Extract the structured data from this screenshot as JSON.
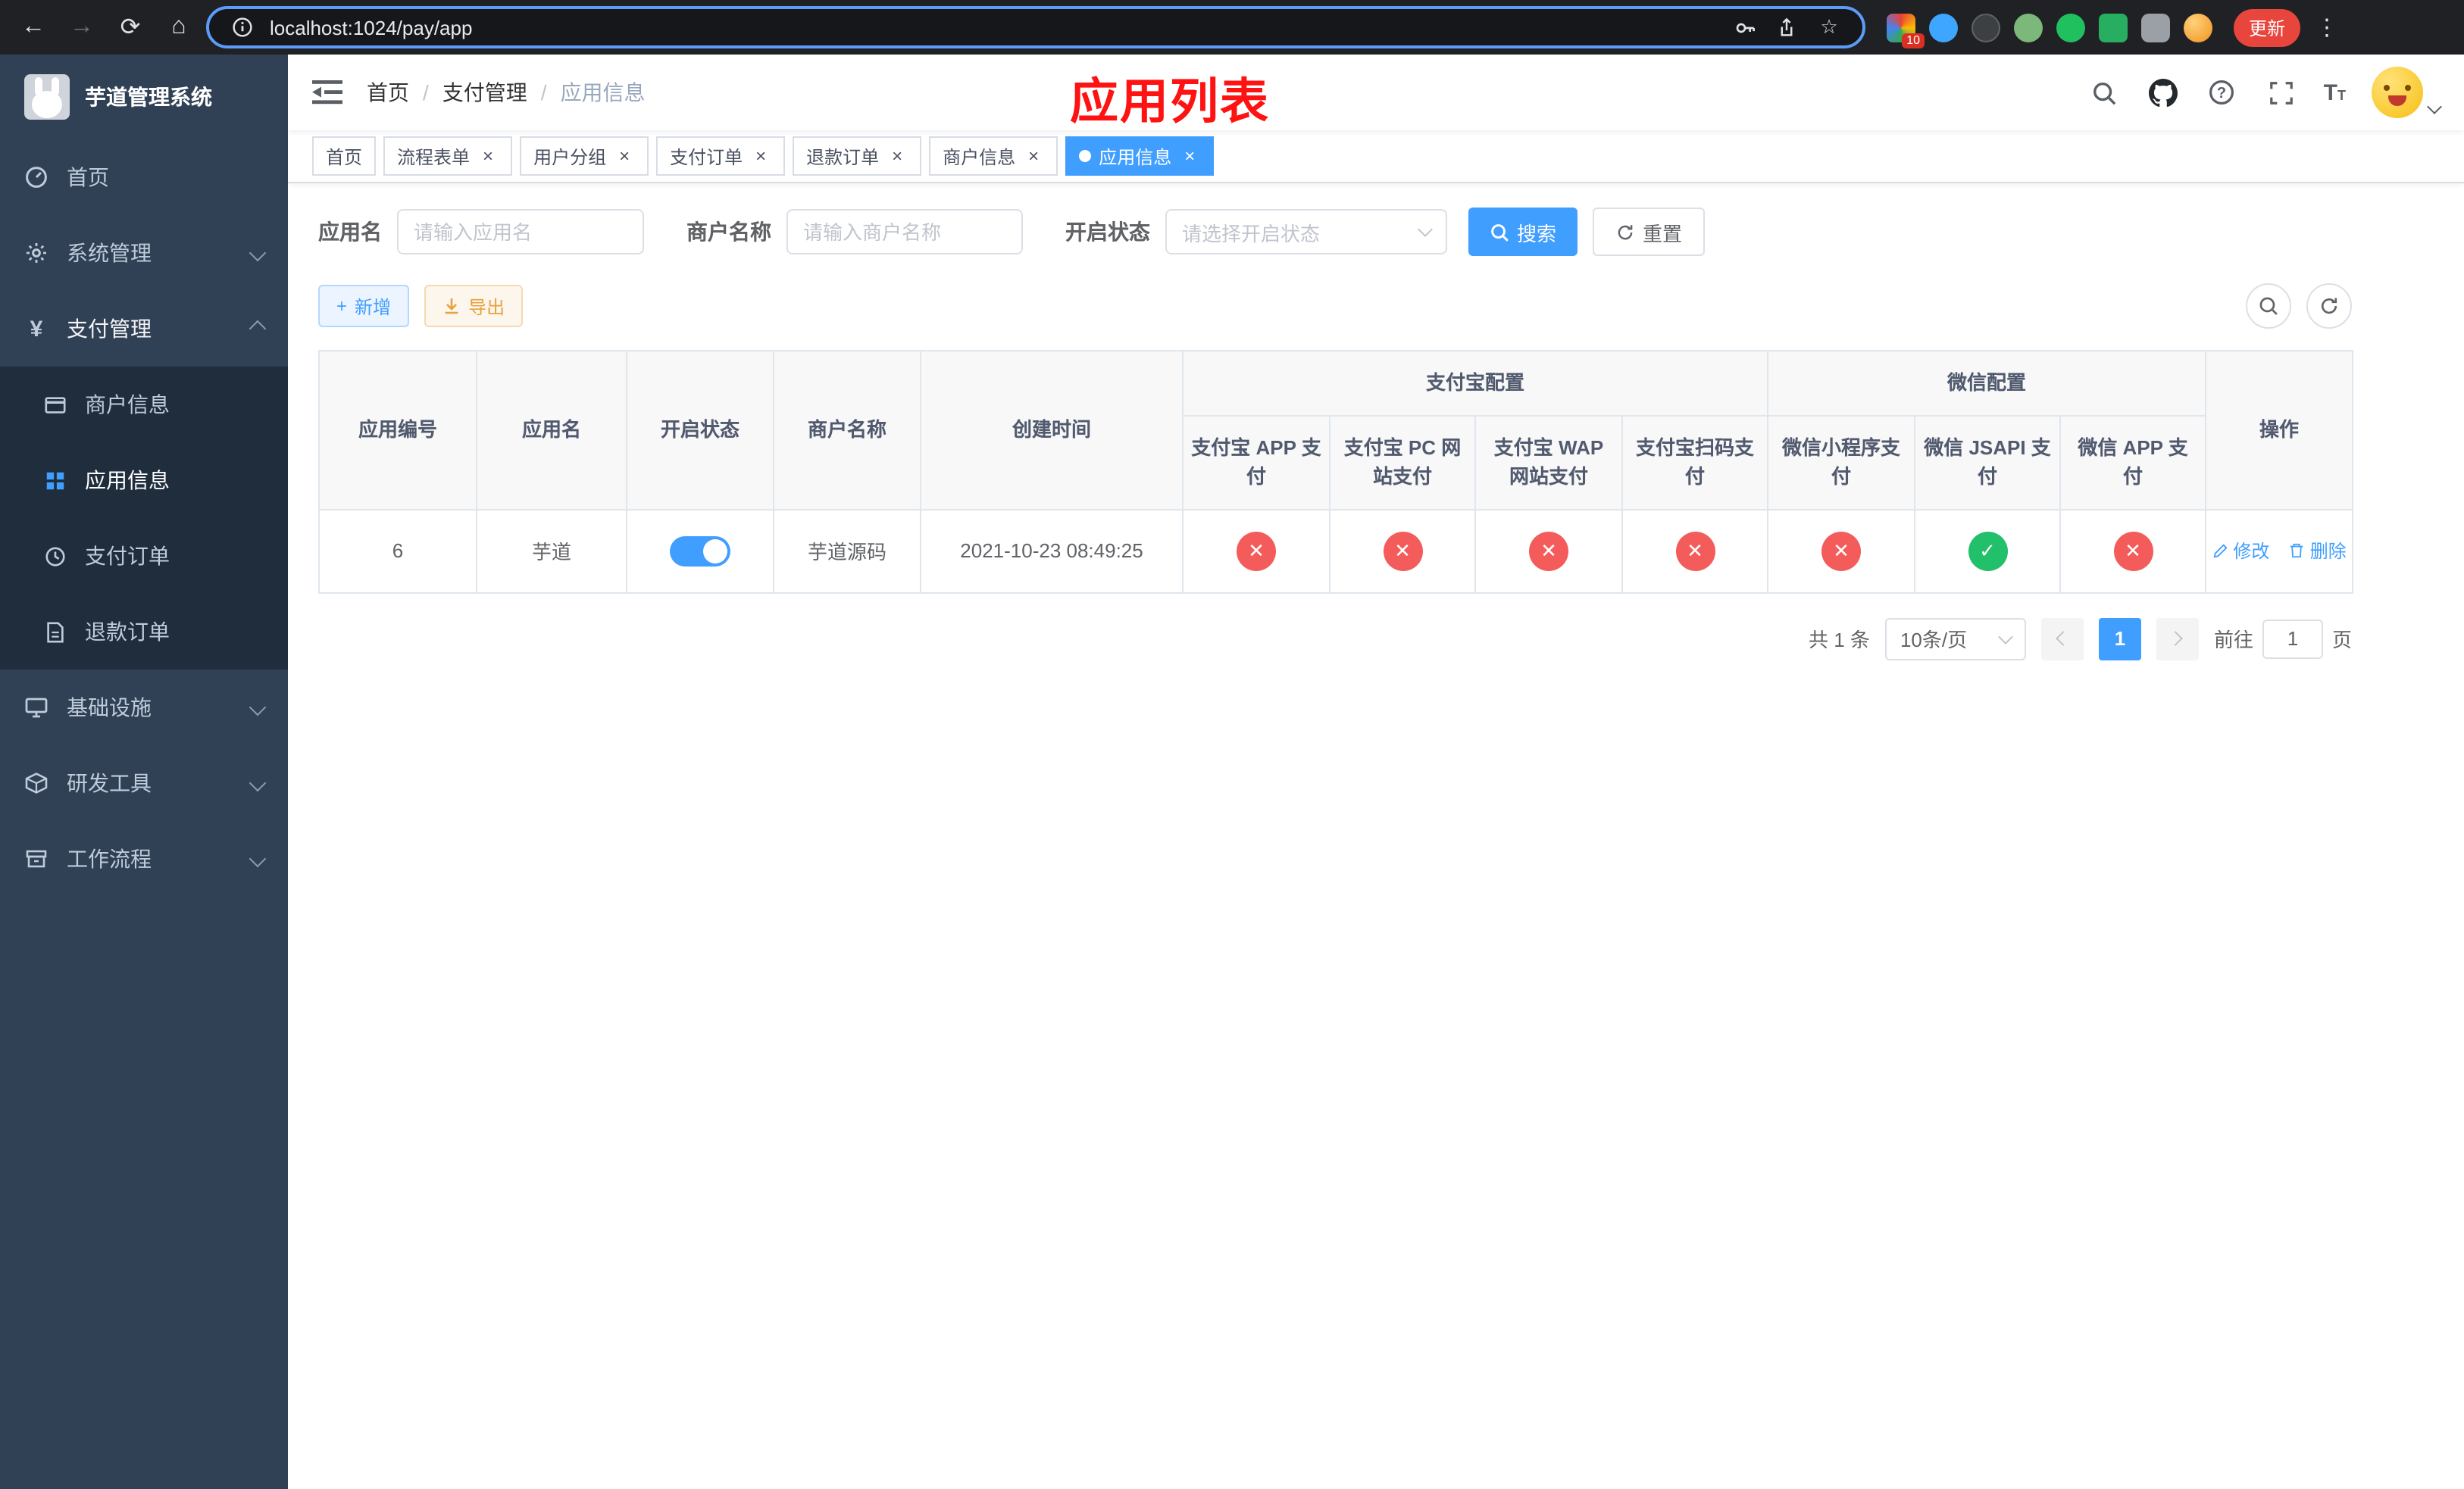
{
  "colors": {
    "accent": "#409eff",
    "danger": "#f45c5c",
    "success": "#22c06a",
    "title_red": "#ff1212",
    "sidebar_bg": "#304156",
    "submenu_bg": "#1f2d3d"
  },
  "icons": {
    "close": "×",
    "separator": "/",
    "more": "⋮",
    "star": "☆",
    "yen": "¥",
    "plus": "+",
    "info": "i"
  },
  "browser": {
    "url": "localhost:1024/pay/app",
    "update_button": "更新",
    "extension_badge": "10"
  },
  "sidebar": {
    "logo_title": "芋道管理系统",
    "home": "首页",
    "system": "系统管理",
    "payment": "支付管理",
    "merchant": "商户信息",
    "app_info": "应用信息",
    "pay_order": "支付订单",
    "refund_order": "退款订单",
    "infra": "基础设施",
    "dev_tools": "研发工具",
    "workflow": "工作流程"
  },
  "header": {
    "breadcrumb": [
      "首页",
      "支付管理",
      "应用信息"
    ],
    "page_title": "应用列表"
  },
  "tabs": [
    {
      "label": "首页"
    },
    {
      "label": "流程表单"
    },
    {
      "label": "用户分组"
    },
    {
      "label": "支付订单"
    },
    {
      "label": "退款订单"
    },
    {
      "label": "商户信息"
    },
    {
      "label": "应用信息"
    }
  ],
  "filters": {
    "app_name_label": "应用名",
    "app_name_placeholder": "请输入应用名",
    "merchant_label": "商户名称",
    "merchant_placeholder": "请输入商户名称",
    "status_label": "开启状态",
    "status_placeholder": "请选择开启状态",
    "search_button": "搜索",
    "reset_button": "重置"
  },
  "toolbar": {
    "add_button": "新增",
    "export_button": "导出"
  },
  "table": {
    "group_alipay": "支付宝配置",
    "group_wechat": "微信配置",
    "columns": [
      "应用编号",
      "应用名",
      "开启状态",
      "商户名称",
      "创建时间",
      "支付宝 APP 支付",
      "支付宝 PC 网站支付",
      "支付宝 WAP 网站支付",
      "支付宝扫码支付",
      "微信小程序支付",
      "微信 JSAPI 支付",
      "微信 APP 支付",
      "操作"
    ],
    "rows": [
      {
        "id": "6",
        "name": "芋道",
        "enabled": true,
        "merchant": "芋道源码",
        "created": "2021-10-23 08:49:25",
        "statuses": [
          false,
          false,
          false,
          false,
          false,
          true,
          false
        ],
        "edit": "修改",
        "delete": "删除"
      }
    ]
  },
  "pagination": {
    "total": "共 1 条",
    "page_size": "10条/页",
    "current": "1",
    "goto": "前往",
    "goto_value": "1",
    "unit": "页"
  }
}
